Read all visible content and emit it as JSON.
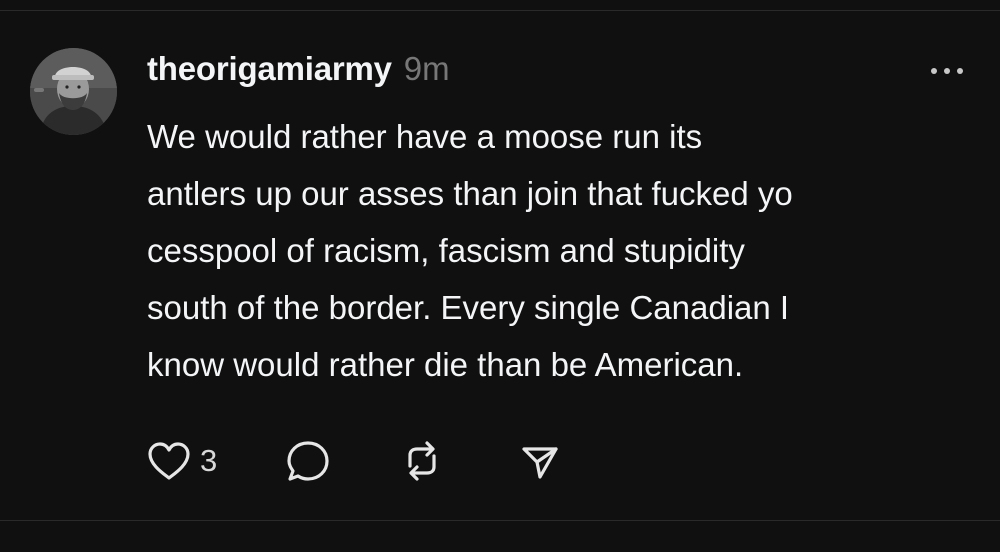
{
  "post": {
    "username": "theorigamiarmy",
    "timestamp": "9m",
    "body_lines": [
      "We would rather have a moose run its",
      "antlers up our asses than join that fucked yo",
      "cesspool of racism, fascism and stupidity",
      "south of the border. Every single Canadian I",
      "know would rather die than be American."
    ],
    "like_count": "3"
  },
  "icons": {
    "more": "more-horizontal-icon",
    "like": "heart-icon",
    "comment": "comment-bubble-icon",
    "repost": "repost-icon",
    "share": "send-icon"
  },
  "colors": {
    "background": "#101010",
    "text_primary": "#f3f5f7",
    "text_secondary": "#777777",
    "divider": "#2a2a2a"
  }
}
